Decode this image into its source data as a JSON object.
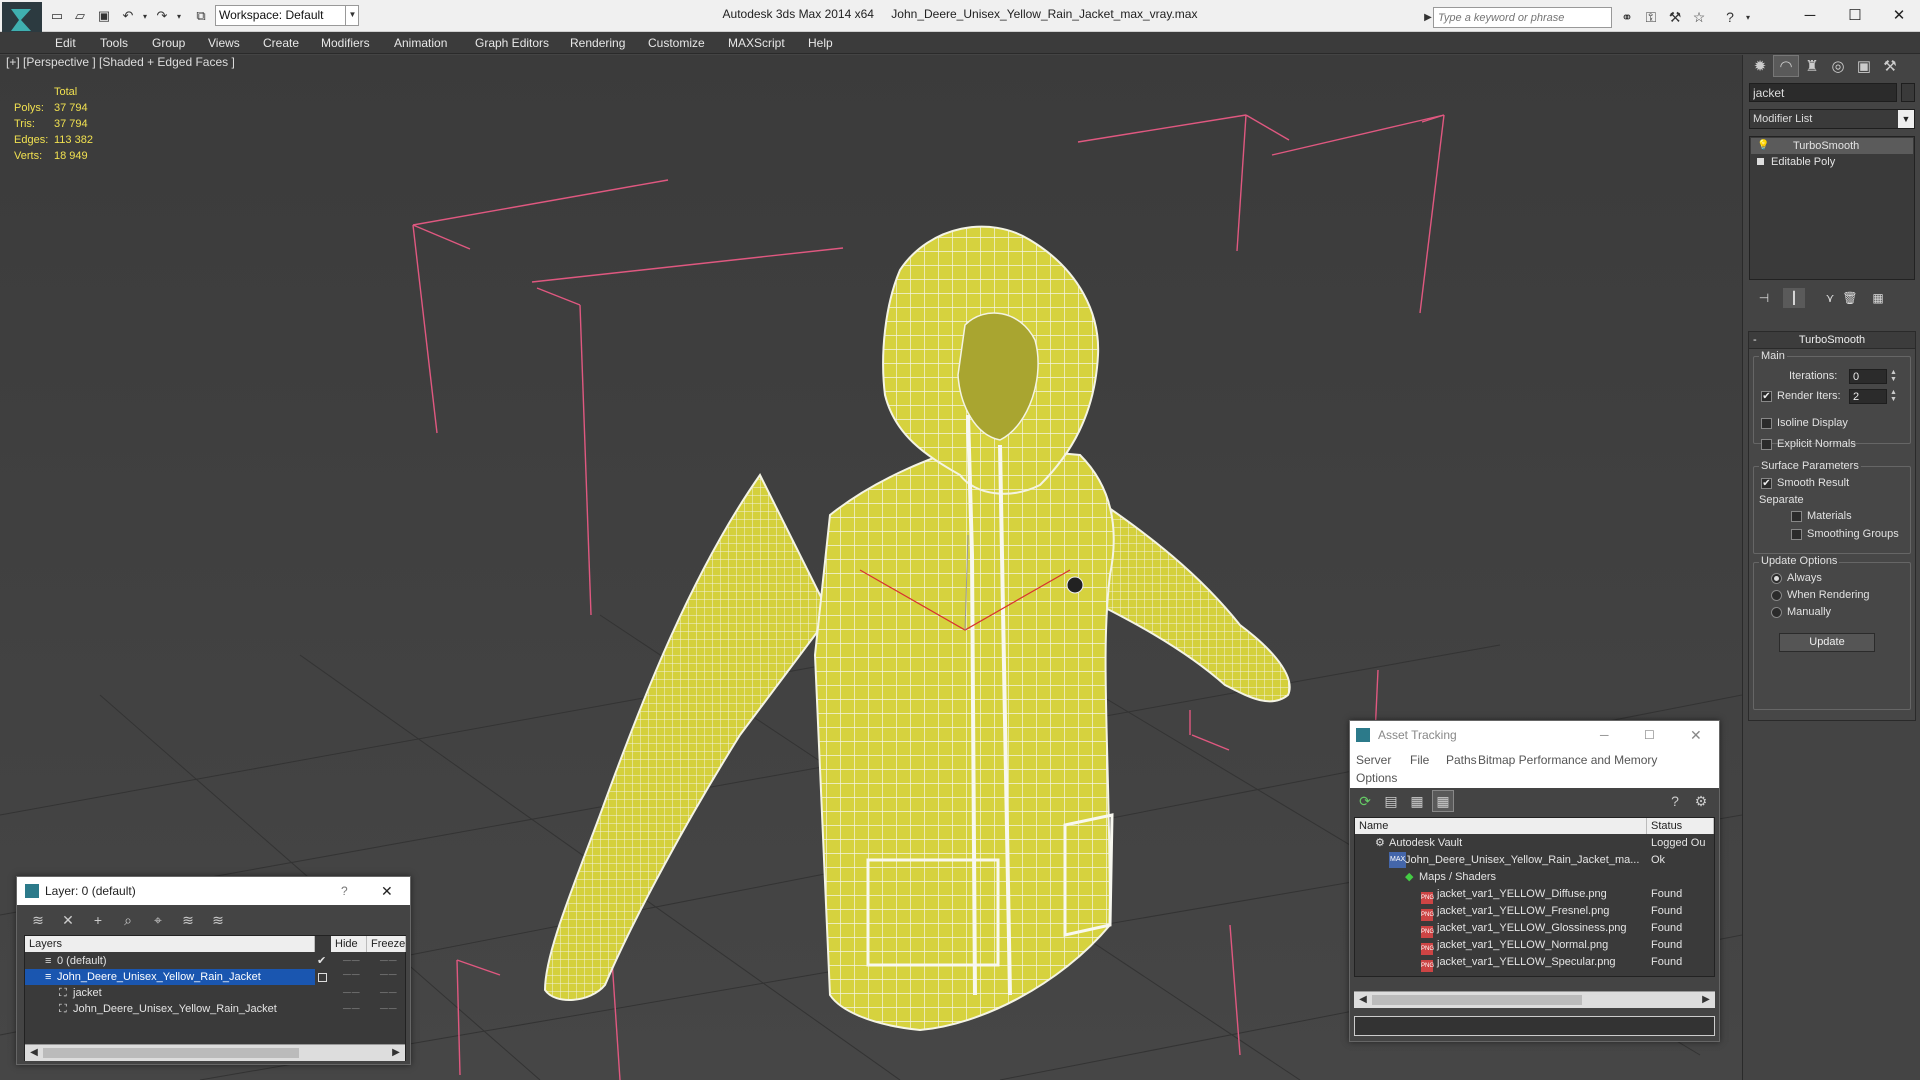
{
  "titlebar": {
    "app_name": "Autodesk 3ds Max  2014 x64",
    "file_name": "John_Deere_Unisex_Yellow_Rain_Jacket_max_vray.max",
    "workspace": "Workspace: Default",
    "search_placeholder": "Type a keyword or phrase"
  },
  "menu": [
    "Edit",
    "Tools",
    "Group",
    "Views",
    "Create",
    "Modifiers",
    "Animation",
    "Graph Editors",
    "Rendering",
    "Customize",
    "MAXScript",
    "Help"
  ],
  "viewport": {
    "label": "[+] [Perspective ] [Shaded + Edged Faces ]",
    "stats_header": "Total",
    "stats": [
      {
        "k": "Polys:",
        "v": "37 794"
      },
      {
        "k": "Tris:",
        "v": "37 794"
      },
      {
        "k": "Edges:",
        "v": "113 382"
      },
      {
        "k": "Verts:",
        "v": "18 949"
      }
    ],
    "stats_color": "#f0e050",
    "mesh_color": "#d8d440",
    "bbox_color": "#e05880"
  },
  "command_panel": {
    "object_name": "jacket",
    "modifier_list": "Modifier List",
    "stack": [
      "TurboSmooth",
      "Editable Poly"
    ],
    "rollout_title": "TurboSmooth",
    "main_label": "Main",
    "iterations_label": "Iterations:",
    "iterations_value": "0",
    "render_iters_label": "Render Iters:",
    "render_iters_value": "2",
    "isoline": "Isoline Display",
    "explicit": "Explicit Normals",
    "surface_params": "Surface Parameters",
    "smooth_result": "Smooth Result",
    "separate": "Separate",
    "materials": "Materials",
    "smoothing_groups": "Smoothing Groups",
    "update_options": "Update Options",
    "always": "Always",
    "when_rendering": "When Rendering",
    "manually": "Manually",
    "update_button": "Update"
  },
  "layer_dialog": {
    "title": "Layer: 0 (default)",
    "help": "?",
    "col_layers": "Layers",
    "col_hide": "Hide",
    "col_freeze": "Freeze",
    "rows": [
      {
        "name": "0 (default)",
        "indent": 1
      },
      {
        "name": "John_Deere_Unisex_Yellow_Rain_Jacket",
        "indent": 1
      },
      {
        "name": "jacket",
        "indent": 2
      },
      {
        "name": "John_Deere_Unisex_Yellow_Rain_Jacket",
        "indent": 2
      }
    ]
  },
  "asset_dialog": {
    "title": "Asset Tracking",
    "menu": [
      "Server",
      "File",
      "Paths",
      "Bitmap Performance and Memory",
      "Options"
    ],
    "col_name": "Name",
    "col_status": "Status",
    "rows": [
      {
        "name": "Autodesk Vault",
        "status": "Logged Ou",
        "indent": 1
      },
      {
        "name": "John_Deere_Unisex_Yellow_Rain_Jacket_ma...",
        "status": "Ok",
        "indent": 2
      },
      {
        "name": "Maps / Shaders",
        "status": "",
        "indent": 3
      },
      {
        "name": "jacket_var1_YELLOW_Diffuse.png",
        "status": "Found",
        "indent": 4
      },
      {
        "name": "jacket_var1_YELLOW_Fresnel.png",
        "status": "Found",
        "indent": 4
      },
      {
        "name": "jacket_var1_YELLOW_Glossiness.png",
        "status": "Found",
        "indent": 4
      },
      {
        "name": "jacket_var1_YELLOW_Normal.png",
        "status": "Found",
        "indent": 4
      },
      {
        "name": "jacket_var1_YELLOW_Specular.png",
        "status": "Found",
        "indent": 4
      }
    ]
  }
}
